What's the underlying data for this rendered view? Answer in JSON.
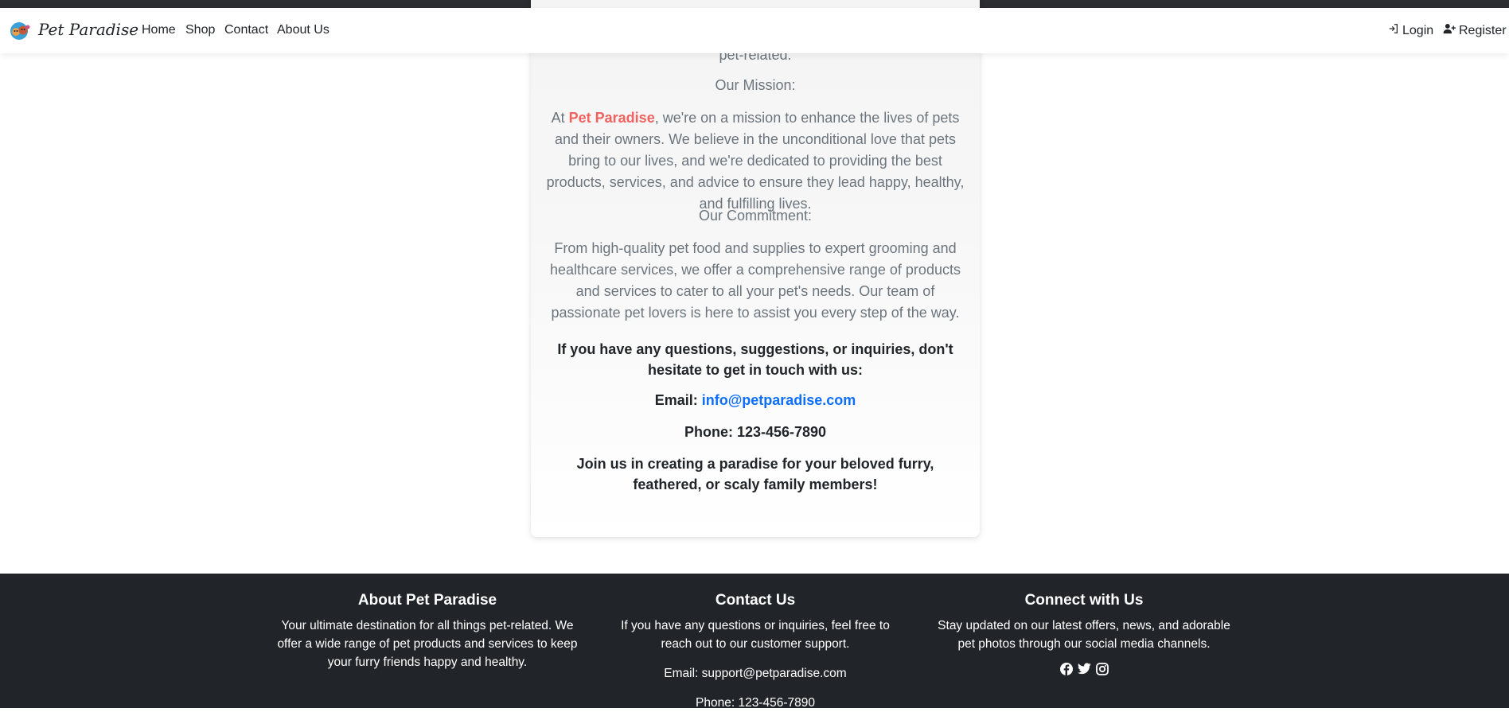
{
  "navbar": {
    "brand": "Pet Paradise",
    "logo_icon": "pet-logo-icon",
    "links": [
      "Home",
      "Shop",
      "Contact",
      "About Us"
    ],
    "login_label": "Login",
    "login_icon": "login-icon",
    "register_label": "Register",
    "register_icon": "user-plus-icon"
  },
  "card": {
    "partial_line": "pet-related.",
    "mission_heading": "Our Mission:",
    "mission_prefix": "At ",
    "mission_brand": "Pet Paradise",
    "mission_text": ", we're on a mission to enhance the lives of pets and their owners. We believe in the unconditional love that pets bring to our lives, and we're dedicated to providing the best products, services, and advice to ensure they lead happy, healthy, and fulfilling lives.",
    "commitment_heading": "Our Commitment:",
    "commitment_text": "From high-quality pet food and supplies to expert grooming and healthcare services, we offer a comprehensive range of products and services to cater to all your pet's needs. Our team of passionate pet lovers is here to assist you every step of the way.",
    "questions_text": "If you have any questions, suggestions, or inquiries, don't hesitate to get in touch with us:",
    "email_label": "Email: ",
    "email_value": "info@petparadise.com",
    "phone_text": "Phone: 123-456-7890",
    "join_text": "Join us in creating a paradise for your beloved furry, feathered, or scaly family members!"
  },
  "footer": {
    "about": {
      "title": "About Pet Paradise",
      "text": "Your ultimate destination for all things pet-related. We offer a wide range of pet products and services to keep your furry friends happy and healthy."
    },
    "contact": {
      "title": "Contact Us",
      "text": "If you have any questions or inquiries, feel free to reach out to our customer support.",
      "email": "Email: support@petparadise.com",
      "phone": "Phone: 123-456-7890"
    },
    "connect": {
      "title": "Connect with Us",
      "text": "Stay updated on our latest offers, news, and adorable pet photos through our social media channels.",
      "icons": [
        "facebook-icon",
        "twitter-icon",
        "instagram-icon"
      ]
    }
  },
  "colors": {
    "brand_accent": "#f0625f",
    "link": "#0d6efd",
    "footer_bg": "#212529",
    "muted_text": "#6c757d"
  }
}
